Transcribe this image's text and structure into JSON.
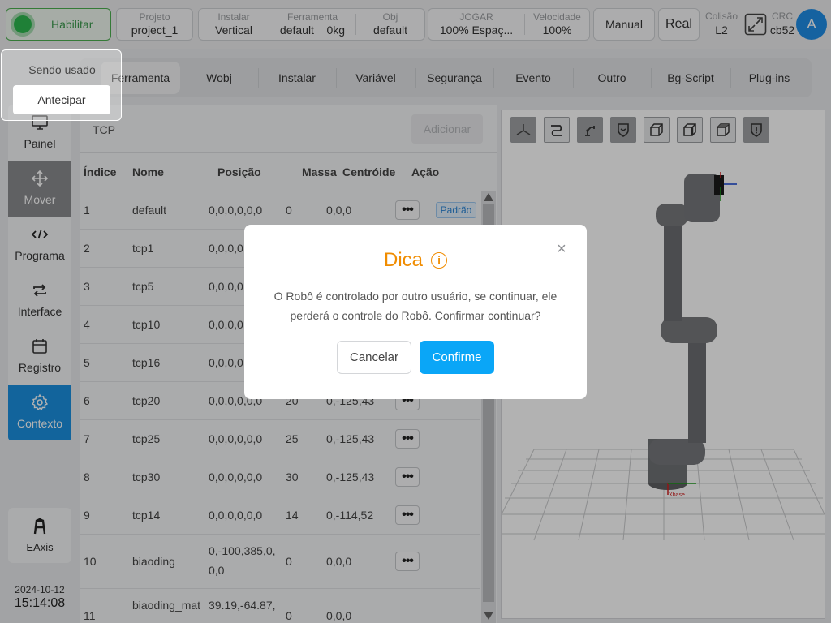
{
  "topbar": {
    "enable_label": "Habilitar",
    "project": {
      "label": "Projeto",
      "value": "project_1"
    },
    "install": {
      "label": "Instalar",
      "value": "Vertical"
    },
    "tool": {
      "label": "Ferramenta",
      "name": "default",
      "weight": "0kg"
    },
    "obj": {
      "label": "Obj",
      "value": "default"
    },
    "jog": {
      "label": "JOGAR",
      "value": "100%  Espaç..."
    },
    "speed": {
      "label": "Velocidade",
      "value": "100%"
    },
    "mode_button": "Manual",
    "real_button": "Real",
    "collision": {
      "label": "Colisão",
      "value": "L2"
    },
    "crc": {
      "label": "CRC",
      "value": "cb52"
    },
    "avatar": "A"
  },
  "popover": {
    "text": "Sendo usado",
    "button": "Antecipar"
  },
  "tabs": [
    "Ferramenta",
    "Wobj",
    "Instalar",
    "Variável",
    "Segurança",
    "Evento",
    "Outro",
    "Bg-Script",
    "Plug-ins"
  ],
  "sidebar": {
    "items": [
      {
        "label": "Painel",
        "icon": "monitor-icon"
      },
      {
        "label": "Mover",
        "icon": "move-icon"
      },
      {
        "label": "Programa",
        "icon": "code-icon"
      },
      {
        "label": "Interface",
        "icon": "swap-icon"
      },
      {
        "label": "Registro",
        "icon": "calendar-icon"
      },
      {
        "label": "Contexto",
        "icon": "gear-icon"
      }
    ],
    "eaxis_label": "EAxis",
    "date": "2024-10-12",
    "time": "15:14:08"
  },
  "table": {
    "section_label": "TCP",
    "add_button": "Adicionar",
    "headers": [
      "Índice",
      "Nome",
      "Posição",
      "Massa",
      "Centróide",
      "Ação"
    ],
    "action_button": "•••",
    "default_badge": "Padrão",
    "rows": [
      {
        "index": "1",
        "name": "default",
        "position": "0,0,0,0,0,0",
        "mass": "0",
        "centroid": "0,0,0"
      },
      {
        "index": "2",
        "name": "tcp1",
        "position": "0,0,0,0",
        "mass": "",
        "centroid": ""
      },
      {
        "index": "3",
        "name": "tcp5",
        "position": "0,0,0,0",
        "mass": "",
        "centroid": ""
      },
      {
        "index": "4",
        "name": "tcp10",
        "position": "0,0,0,0",
        "mass": "",
        "centroid": ""
      },
      {
        "index": "5",
        "name": "tcp16",
        "position": "0,0,0,0",
        "mass": "",
        "centroid": ""
      },
      {
        "index": "6",
        "name": "tcp20",
        "position": "0,0,0,0,0,0",
        "mass": "20",
        "centroid": "0,-125,43"
      },
      {
        "index": "7",
        "name": "tcp25",
        "position": "0,0,0,0,0,0",
        "mass": "25",
        "centroid": "0,-125,43"
      },
      {
        "index": "8",
        "name": "tcp30",
        "position": "0,0,0,0,0,0",
        "mass": "30",
        "centroid": "0,-125,43"
      },
      {
        "index": "9",
        "name": "tcp14",
        "position": "0,0,0,0,0,0",
        "mass": "14",
        "centroid": "0,-114,52"
      },
      {
        "index": "10",
        "name": "biaoding",
        "position": "0,-100,385,0,",
        "position2": "0,0",
        "mass": "0",
        "centroid": "0,0,0"
      },
      {
        "index": "11",
        "name": "biaoding_mat",
        "position": "39.19,-64.87,",
        "mass": "0",
        "centroid": "0,0,0"
      }
    ]
  },
  "viewport": {
    "tools": [
      "axes-icon",
      "path-icon",
      "robot-arm-icon",
      "shield-icon",
      "cube-front-icon",
      "cube-side-icon",
      "cube-top-icon",
      "warning-shield-icon"
    ],
    "axis_label": "Xbase"
  },
  "modal": {
    "title": "Dica",
    "info_glyph": "i",
    "close_glyph": "×",
    "message": "O Robô é controlado por outro usuário, se continuar, ele perderá o controle do Robô. Confirmar continuar?",
    "cancel": "Cancelar",
    "confirm": "Confirme"
  },
  "colors": {
    "accent": "#0aa6f7",
    "sidebar_active": "#1a90e0",
    "enable_green": "#2db84f",
    "warning_orange": "#f08c00"
  }
}
